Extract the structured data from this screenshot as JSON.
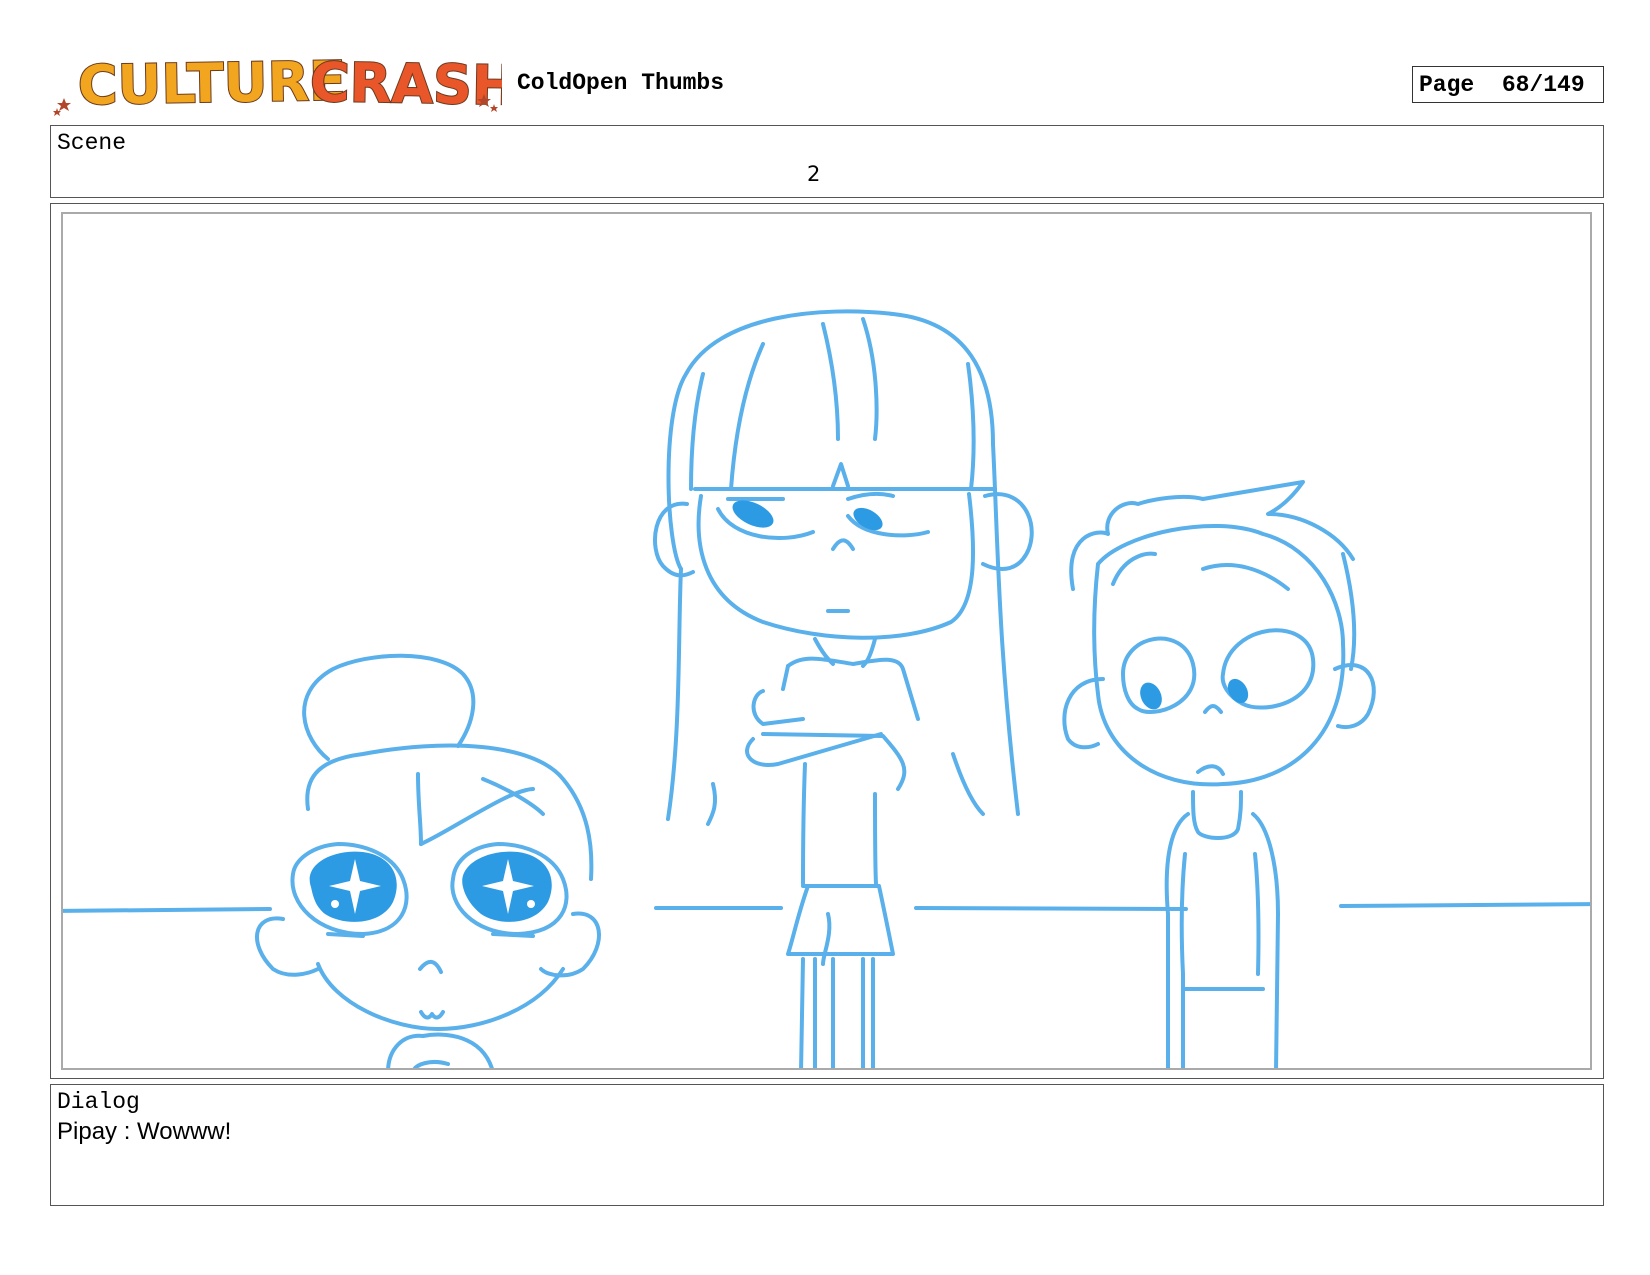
{
  "header": {
    "logo_text": "CULTURE CRASH",
    "title": "ColdOpen Thumbs",
    "page_label": "Page",
    "page_value": "68/149"
  },
  "scene": {
    "label": "Scene",
    "value": "2"
  },
  "panel": {
    "sketch_color": "#5ab0ea",
    "fill_color": "#2d9be3",
    "characters": [
      "girl-with-bun-starry-eyes",
      "tall-girl-arms-crossed",
      "boy-spiky-hair"
    ]
  },
  "dialog": {
    "label": "Dialog",
    "lines": [
      "Pipay : Wowww!"
    ]
  },
  "colors": {
    "logo_culture": "#f2a51f",
    "logo_crash": "#e8562a",
    "logo_outline": "#6b3a1e",
    "logo_stars": "#b2452a"
  }
}
